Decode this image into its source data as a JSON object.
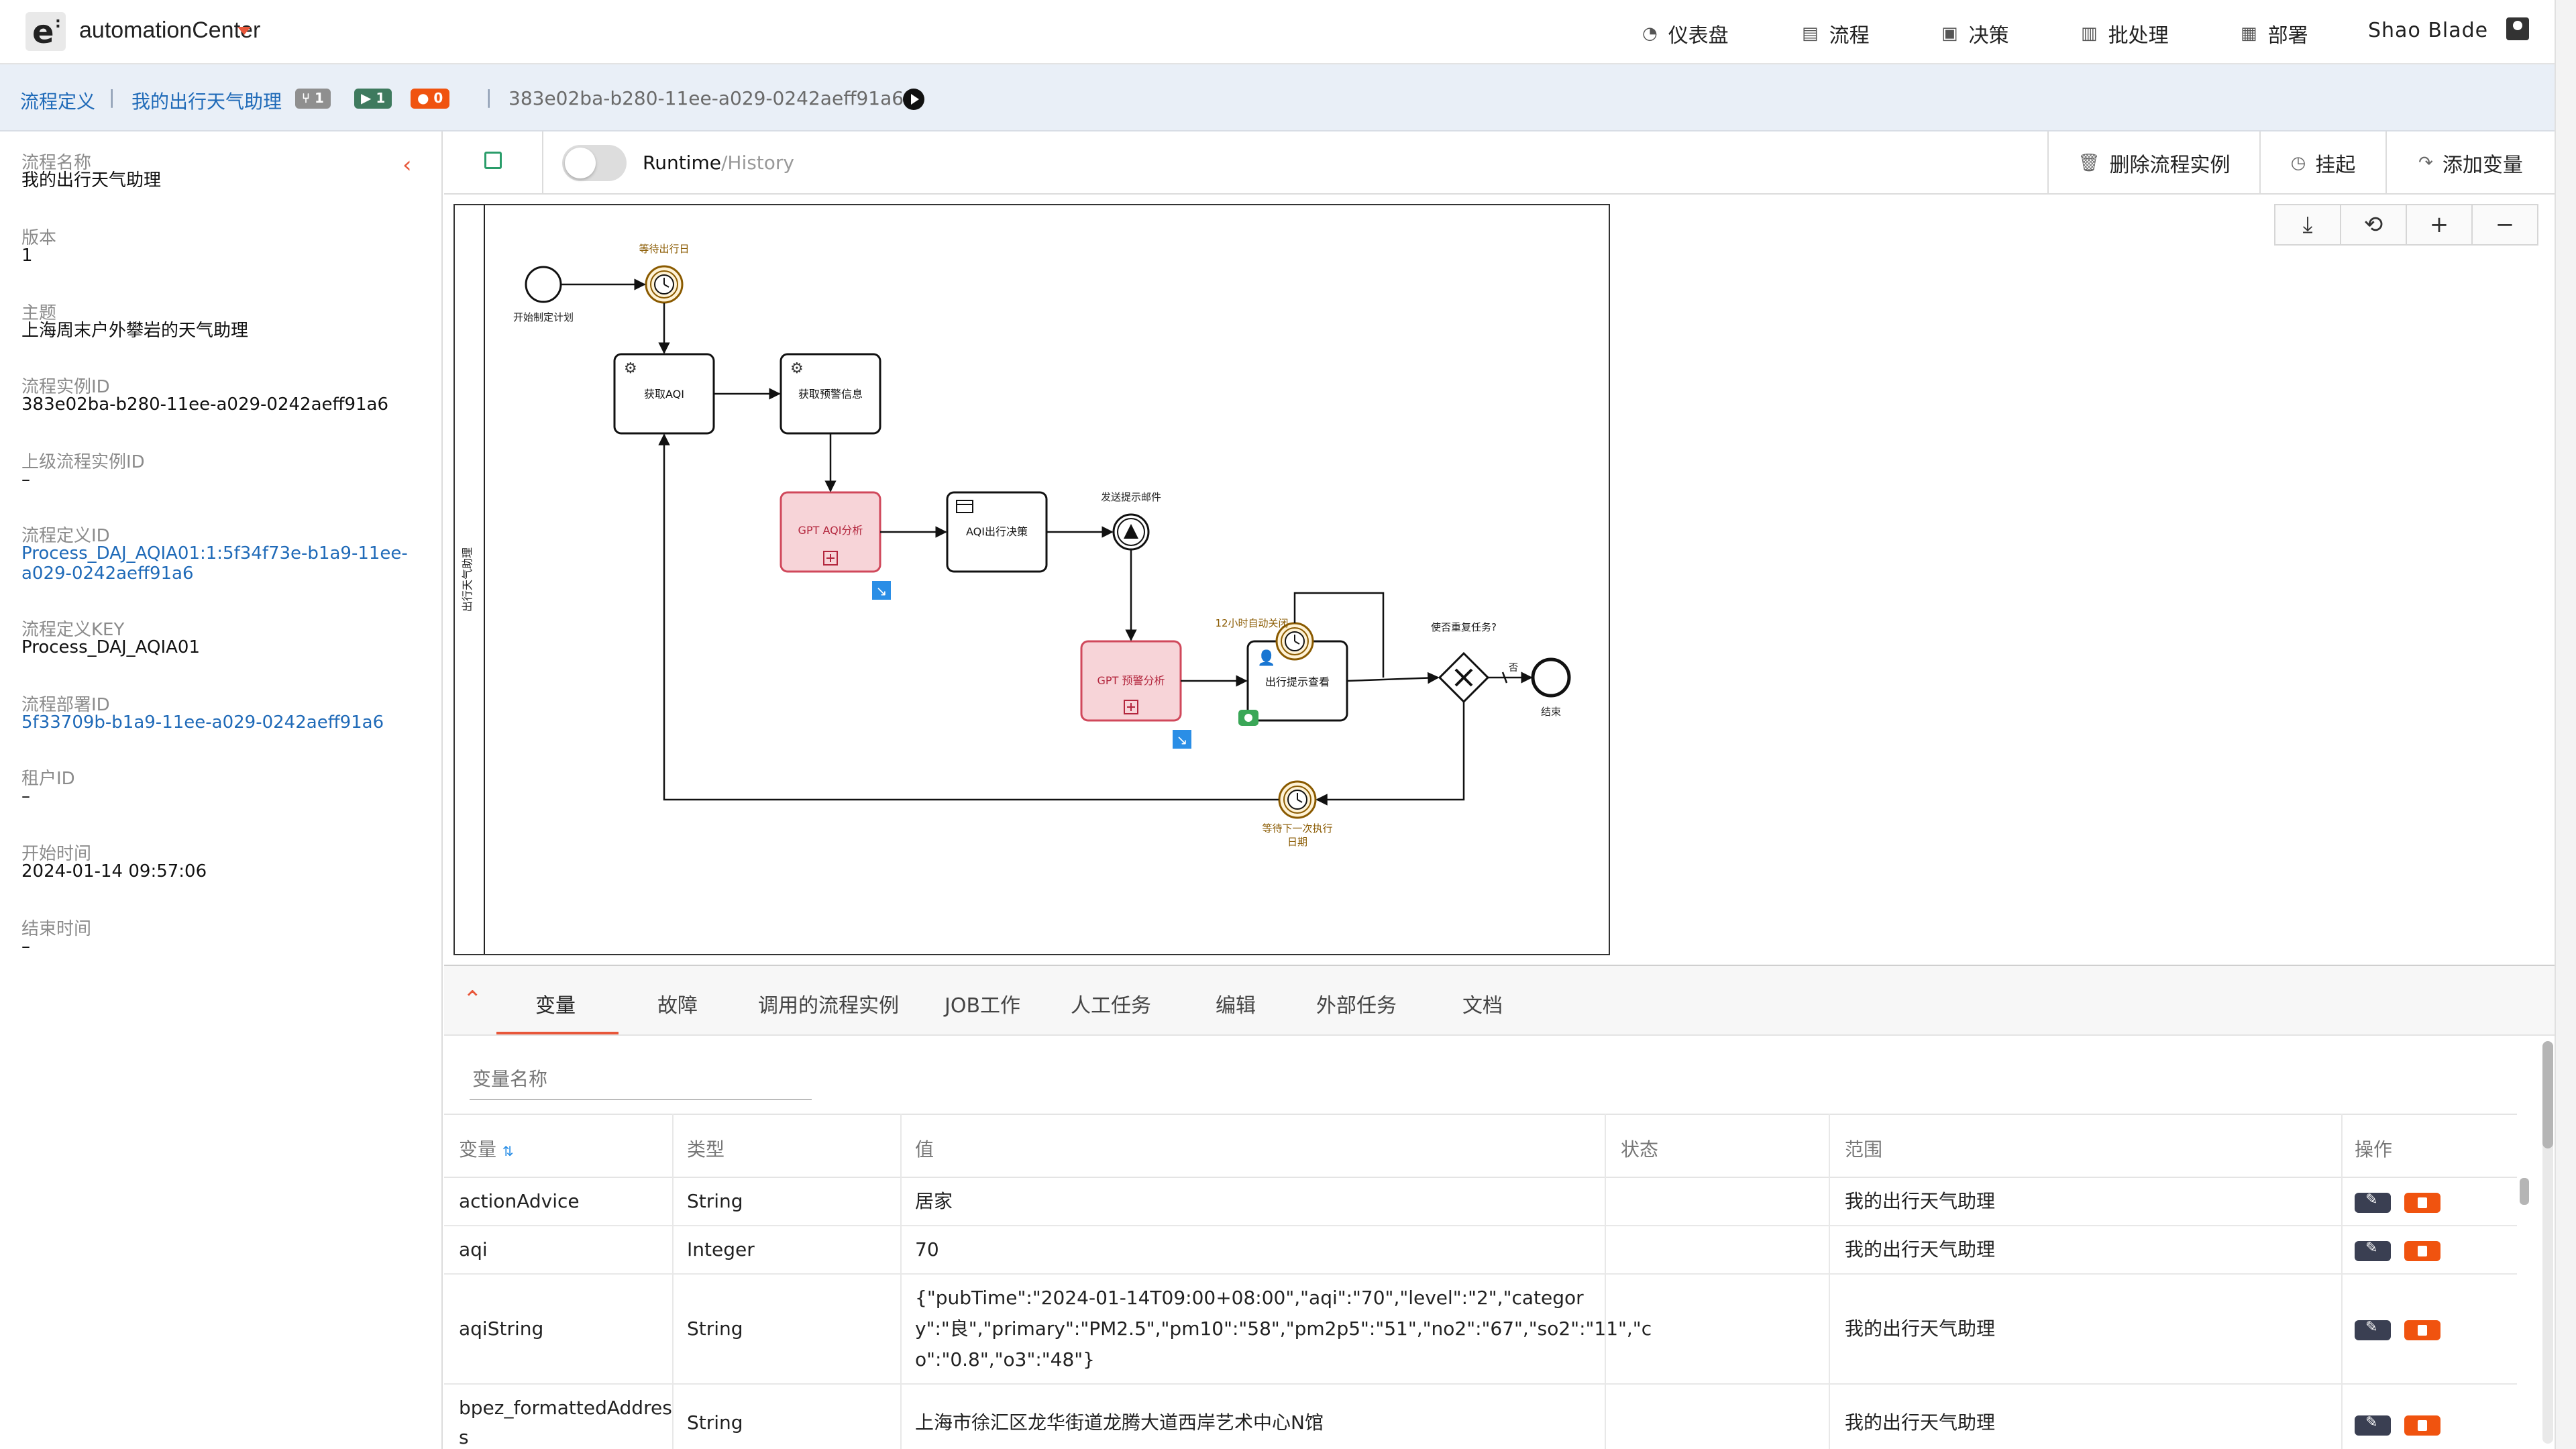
{
  "app": {
    "name": "automationCenter"
  },
  "nav": {
    "items": [
      {
        "label": "仪表盘",
        "icon": "dashboard-icon"
      },
      {
        "label": "流程",
        "icon": "process-icon"
      },
      {
        "label": "决策",
        "icon": "decision-icon"
      },
      {
        "label": "批处理",
        "icon": "batch-icon"
      },
      {
        "label": "部署",
        "icon": "deploy-icon"
      }
    ],
    "user": "Shao Blade"
  },
  "breadcrumb": {
    "root": "流程定义",
    "current": "我的出行天气助理",
    "badges": [
      {
        "value": "1",
        "icon": "branch-icon",
        "color": "#8f8f8f"
      },
      {
        "value": "1",
        "icon": "play-icon",
        "color": "#3e7a5e"
      },
      {
        "value": "0",
        "icon": "alert-icon",
        "color": "#f0530f"
      }
    ],
    "instance_id": "383e02ba-b280-11ee-a029-0242aeff91a6"
  },
  "details": {
    "fields": [
      {
        "label": "流程名称",
        "value": "我的出行天气助理"
      },
      {
        "label": "版本",
        "value": "1"
      },
      {
        "label": "主题",
        "value": "上海周末户外攀岩的天气助理"
      },
      {
        "label": "流程实例ID",
        "value": "383e02ba-b280-11ee-a029-0242aeff91a6"
      },
      {
        "label": "上级流程实例ID",
        "value": "–"
      },
      {
        "label": "流程定义ID",
        "value": "Process_DAJ_AQIA01:1:5f34f73e-b1a9-11ee-a029-0242aeff91a6",
        "value_line1": "Process_DAJ_AQIA01:1:5f34f73e-b1a9-11ee-",
        "value_line2": "a029-0242aeff91a6"
      },
      {
        "label": "流程定义KEY",
        "value": "Process_DAJ_AQIA01"
      },
      {
        "label": "流程部署ID",
        "value": "5f33709b-b1a9-11ee-a029-0242aeff91a6"
      },
      {
        "label": "租户ID",
        "value": "–"
      },
      {
        "label": "开始时间",
        "value": "2024-01-14 09:57:06"
      },
      {
        "label": "结束时间",
        "value": "–"
      }
    ]
  },
  "toolbar": {
    "runtime": "Runtime",
    "history": "/History",
    "delete_label": "删除流程实例",
    "suspend_label": "挂起",
    "add_var_label": "添加变量"
  },
  "diagram": {
    "lane_label": "出行天气助理",
    "start_label": "开始制定计划",
    "timer1_label": "等待出行日",
    "task_aqi": "获取AQI",
    "task_warning": "获取预警信息",
    "task_gpt_aqi": "GPT AQI分析",
    "task_aqi_decision": "AQI出行决策",
    "event_send_mail": "发送提示邮件",
    "task_gpt_warning": "GPT 预警分析",
    "timer_12h": "12小时自动关闭",
    "task_view": "出行提示查看",
    "gateway_label": "使否重复任务?",
    "no_label": "否",
    "end_label": "结束",
    "timer_next_line1": "等待下一次执行",
    "timer_next_line2": "日期"
  },
  "bottom": {
    "tabs": [
      "变量",
      "故障",
      "调用的流程实例",
      "JOB工作",
      "人工任务",
      "编辑",
      "外部任务",
      "文档"
    ],
    "filter_placeholder": "变量名称",
    "columns": [
      "变量",
      "类型",
      "值",
      "状态",
      "范围",
      "操作"
    ],
    "rows": [
      {
        "name": "actionAdvice",
        "type": "String",
        "value": "居家",
        "status": "",
        "scope": "我的出行天气助理"
      },
      {
        "name": "aqi",
        "type": "Integer",
        "value": "70",
        "status": "",
        "scope": "我的出行天气助理"
      },
      {
        "name": "aqiString",
        "type": "String",
        "value_lines": [
          "{\"pubTime\":\"2024-01-14T09:00+08:00\",\"aqi\":\"70\",\"level\":\"2\",\"categor",
          "y\":\"良\",\"primary\":\"PM2.5\",\"pm10\":\"58\",\"pm2p5\":\"51\",\"no2\":\"67\",\"so2\":\"11\",\"c",
          "o\":\"0.8\",\"o3\":\"48\"}"
        ],
        "status": "",
        "scope": "我的出行天气助理"
      },
      {
        "name_lines": [
          "bpez_formattedAddres",
          "s"
        ],
        "type": "String",
        "value": "上海市徐汇区龙华街道龙腾大道西岸艺术中心N馆",
        "status": "",
        "scope": "我的出行天气助理"
      }
    ]
  },
  "colors": {
    "accent": "#e8573a",
    "link": "#1f6ab8",
    "gpt_fill": "#f7d4d8",
    "gpt_stroke": "#d0485b",
    "timer": "#c68a1e"
  }
}
